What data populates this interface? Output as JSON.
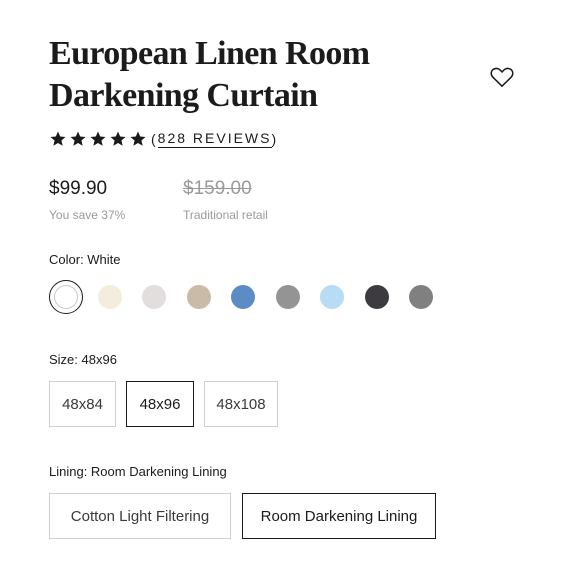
{
  "product": {
    "title_line1": "European Linen Room",
    "title_line2": "Darkening Curtain"
  },
  "rating": {
    "stars": 5,
    "reviews_open": "(",
    "reviews_text": "828 REVIEWS",
    "reviews_close": ")"
  },
  "pricing": {
    "current": "$99.90",
    "savings": "You save 37%",
    "original": "$159.00",
    "original_label": "Traditional retail"
  },
  "color": {
    "label": "Color: White",
    "selected": "White",
    "swatches": [
      "#ffffff",
      "#f4ecdc",
      "#e1dedd",
      "#c9bba7",
      "#5b8cc6",
      "#949494",
      "#b8dcf3",
      "#3e3b40",
      "#808080"
    ]
  },
  "size": {
    "label": "Size: 48x96",
    "options": [
      "48x84",
      "48x96",
      "48x108"
    ],
    "selected": "48x96"
  },
  "lining": {
    "label": "Lining: Room Darkening Lining",
    "options": [
      "Cotton Light Filtering",
      "Room Darkening Lining"
    ],
    "selected": "Room Darkening Lining"
  }
}
